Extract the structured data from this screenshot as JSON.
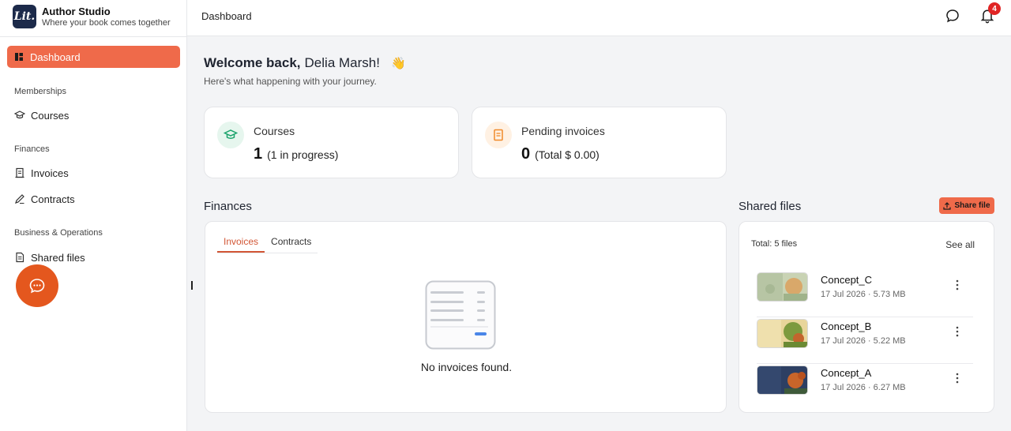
{
  "brand": {
    "logo_text": "Lit.",
    "title": "Author Studio",
    "subtitle": "Where your book comes together"
  },
  "nav": {
    "active_label": "Dashboard",
    "sections": [
      {
        "label": "Memberships",
        "items": [
          {
            "label": "Courses",
            "icon": "graduation-cap-icon"
          }
        ]
      },
      {
        "label": "Finances",
        "items": [
          {
            "label": "Invoices",
            "icon": "receipt-icon"
          },
          {
            "label": "Contracts",
            "icon": "pen-icon"
          }
        ]
      },
      {
        "label": "Business & Operations",
        "items": [
          {
            "label": "Shared files",
            "icon": "document-icon"
          }
        ]
      }
    ]
  },
  "topbar": {
    "breadcrumb": "Dashboard",
    "notification_count": "4"
  },
  "welcome": {
    "prefix": "Welcome back,",
    "name": "Delia Marsh!",
    "emoji": "👋",
    "subtitle": "Here's what happening with your journey."
  },
  "stats": [
    {
      "title": "Courses",
      "number": "1",
      "detail": "(1 in progress)",
      "color": "#1aa36b",
      "bg": "#e6f6ee"
    },
    {
      "title": "Pending invoices",
      "number": "0",
      "detail": "(Total $ 0.00)",
      "color": "#f08a2b",
      "bg": "#fff1e3"
    }
  ],
  "finances": {
    "title": "Finances",
    "tabs": [
      "Invoices",
      "Contracts"
    ],
    "active_tab": "Invoices",
    "empty_text": "No invoices found."
  },
  "shared_files": {
    "title": "Shared files",
    "share_label": "Share file",
    "total": "Total: 5 files",
    "see_all": "See all",
    "files": [
      {
        "name": "Concept_C",
        "meta": "17 Jul 2026 · 5.73 MB"
      },
      {
        "name": "Concept_B",
        "meta": "17 Jul 2026 · 5.22 MB"
      },
      {
        "name": "Concept_A",
        "meta": "17 Jul 2026 · 6.27 MB"
      }
    ]
  },
  "colors": {
    "accent": "#ef6a4a",
    "fab": "#e4571e",
    "badge": "#e02424"
  }
}
